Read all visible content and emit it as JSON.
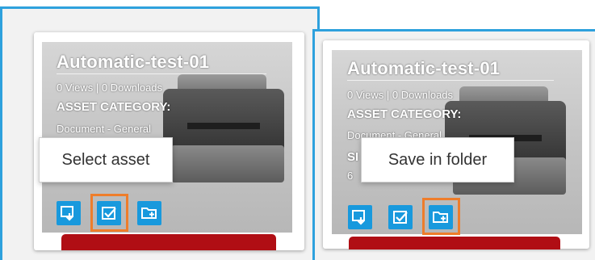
{
  "cards": [
    {
      "title": "Automatic-test-01",
      "stats": "0 Views | 0 Downloads",
      "category_label": "ASSET CATEGORY:",
      "category_value": "Document - General",
      "tooltip": "Select asset",
      "highlighted_action": "select-asset-button"
    },
    {
      "title": "Automatic-test-01",
      "stats": "0 Views | 0 Downloads",
      "category_label": "ASSET CATEGORY:",
      "category_value_partial": "Document - General",
      "extra_label_partial": "SI",
      "extra_value_partial": "6",
      "tooltip": "Save in folder",
      "highlighted_action": "save-in-folder-button"
    }
  ],
  "icons": {
    "download": "download-icon",
    "select": "checkbox-icon",
    "folder": "folder-add-icon"
  },
  "colors": {
    "panel_border": "#2ea1dd",
    "action_button": "#1899dd",
    "highlight": "#ee7d2b",
    "action_bar": "#b00e14"
  }
}
